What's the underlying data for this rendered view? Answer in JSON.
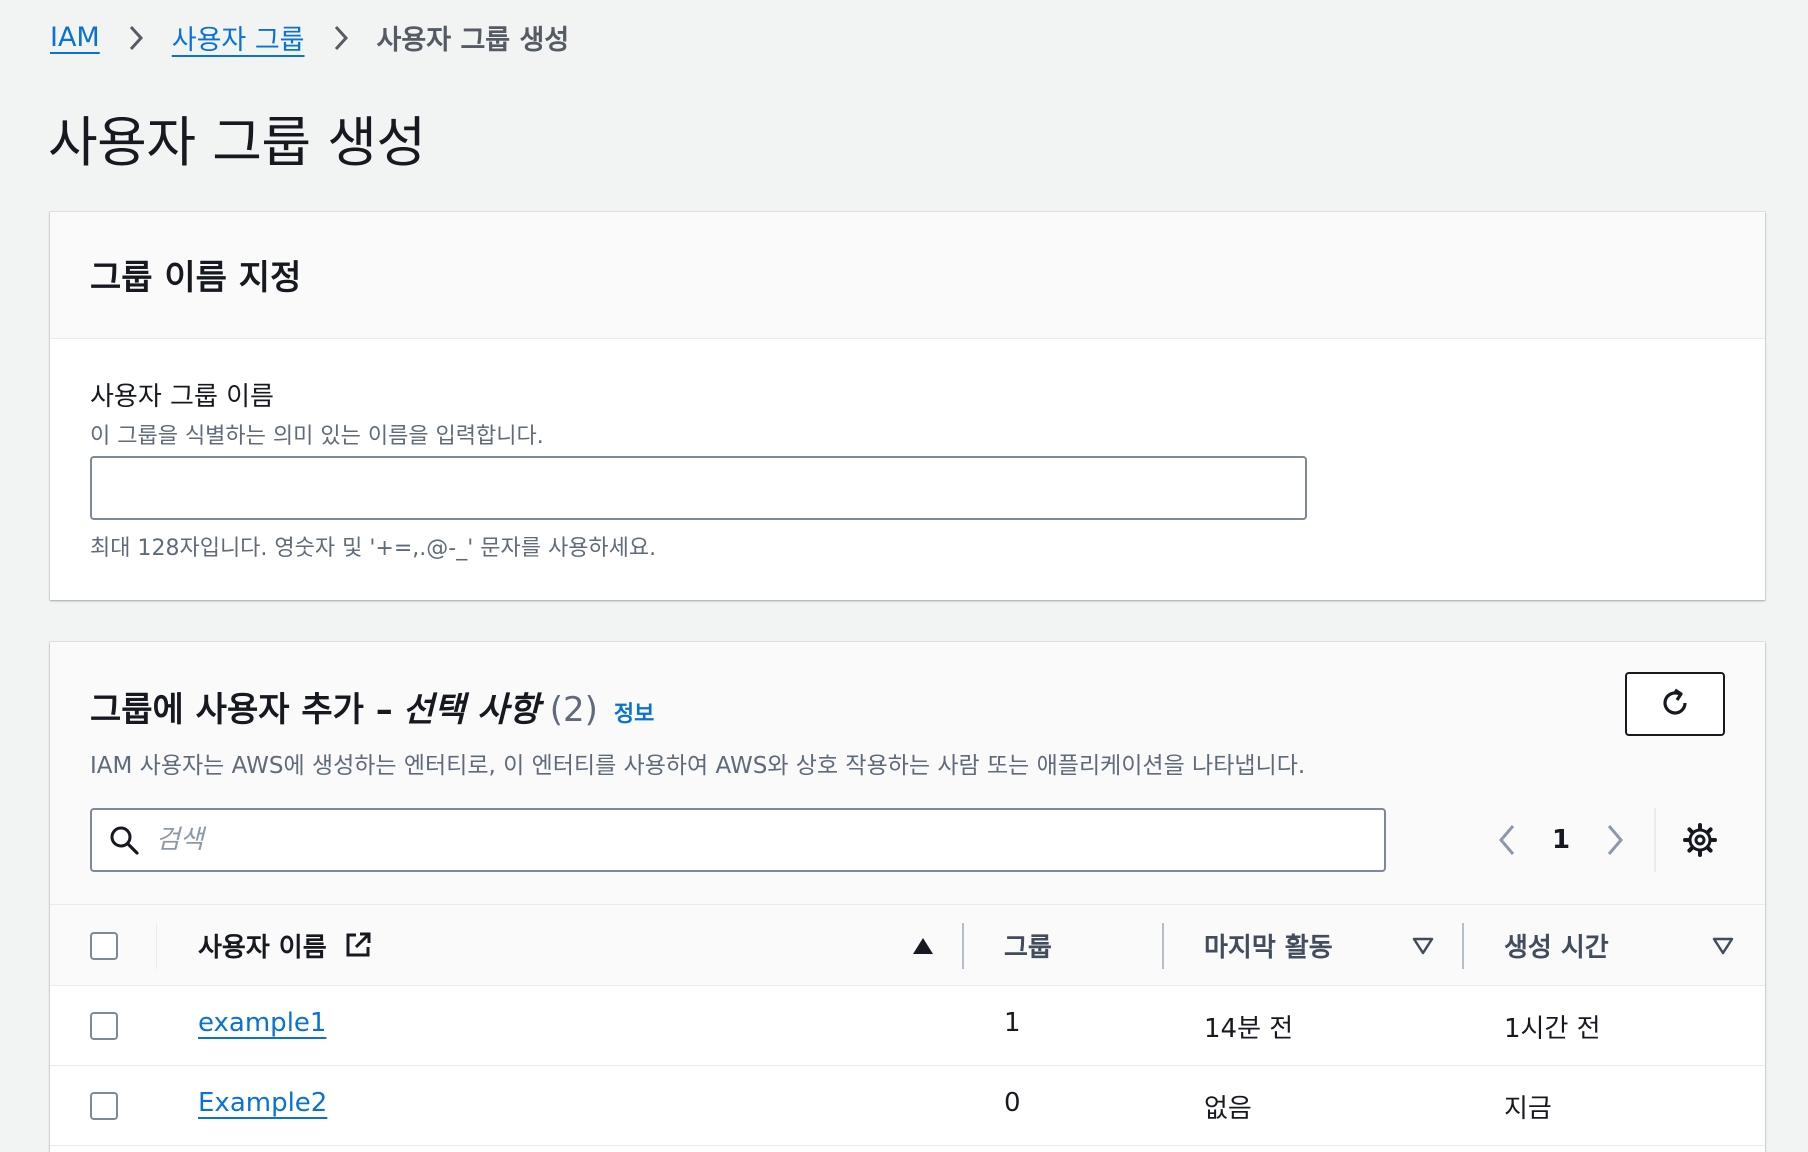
{
  "breadcrumb": {
    "items": [
      {
        "label": "IAM"
      },
      {
        "label": "사용자 그룹"
      },
      {
        "label": "사용자 그룹 생성"
      }
    ]
  },
  "page": {
    "title": "사용자 그룹 생성"
  },
  "group_name_panel": {
    "heading": "그룹 이름 지정",
    "field_label": "사용자 그룹 이름",
    "field_description": "이 그룹을 식별하는 의미 있는 이름을 입력합니다.",
    "field_value": "",
    "field_hint": "최대 128자입니다. 영숫자 및 '+=,.@-_' 문자를 사용하세요."
  },
  "users_panel": {
    "heading": "그룹에 사용자 추가 –",
    "heading_optional": "선택 사항",
    "count": "(2)",
    "info_link": "정보",
    "description": "IAM 사용자는 AWS에 생성하는 엔터티로, 이 엔터티를 사용하여 AWS와 상호 작용하는 사람 또는 애플리케이션을 나타냅니다.",
    "search_placeholder": "검색",
    "current_page": "1",
    "icons": {
      "refresh": "refresh-icon",
      "search": "search-icon",
      "prev": "chevron-left-icon",
      "next": "chevron-right-icon",
      "settings": "gear-icon",
      "external": "external-link-icon"
    },
    "columns": [
      {
        "label": "사용자 이름",
        "sort": "ascending"
      },
      {
        "label": "그룹",
        "sort": "none"
      },
      {
        "label": "마지막 활동",
        "sort": "sortable"
      },
      {
        "label": "생성 시간",
        "sort": "sortable"
      }
    ],
    "rows": [
      {
        "user_name": "example1",
        "groups": "1",
        "last_activity": "14분 전",
        "creation_time": "1시간 전"
      },
      {
        "user_name": "Example2",
        "groups": "0",
        "last_activity": "없음",
        "creation_time": "지금"
      }
    ]
  },
  "colors": {
    "background": "#f2f3f3",
    "link": "#0972d3",
    "text": "#16191f",
    "secondary_text": "#5f6b7a"
  }
}
